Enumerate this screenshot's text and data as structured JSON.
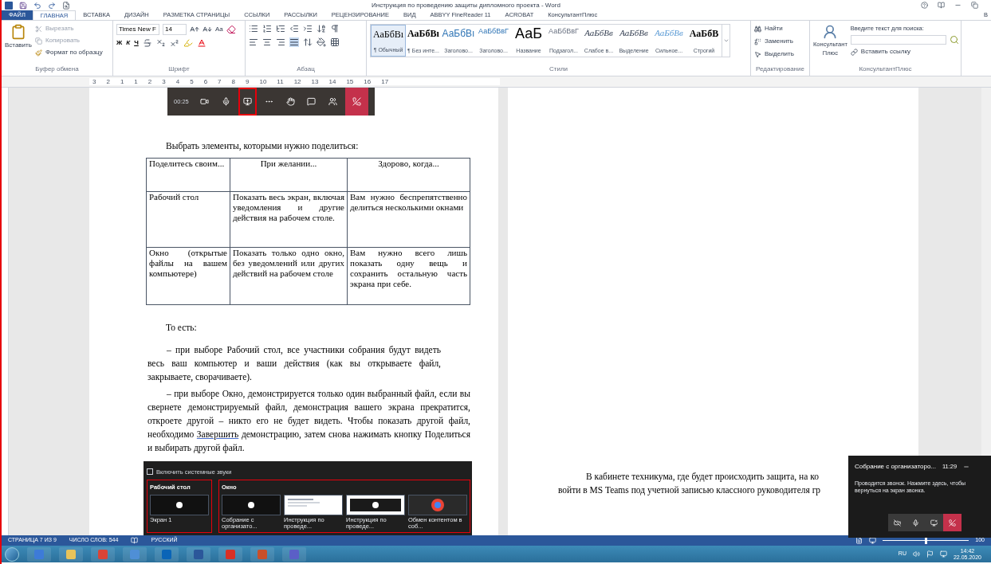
{
  "window": {
    "title": "Инструкция по проведению защиты дипломного проекта - Word",
    "account": "В"
  },
  "ribbon_tabs": [
    {
      "label": "ФАЙЛ",
      "kind": "file",
      "selected": false
    },
    {
      "label": "ГЛАВНАЯ",
      "kind": "tab",
      "selected": true
    },
    {
      "label": "ВСТАВКА",
      "kind": "tab",
      "selected": false
    },
    {
      "label": "ДИЗАЙН",
      "kind": "tab",
      "selected": false
    },
    {
      "label": "РАЗМЕТКА СТРАНИЦЫ",
      "kind": "tab",
      "selected": false
    },
    {
      "label": "ССЫЛКИ",
      "kind": "tab",
      "selected": false
    },
    {
      "label": "РАССЫЛКИ",
      "kind": "tab",
      "selected": false
    },
    {
      "label": "РЕЦЕНЗИРОВАНИЕ",
      "kind": "tab",
      "selected": false
    },
    {
      "label": "ВИД",
      "kind": "tab",
      "selected": false
    },
    {
      "label": "ABBYY FineReader 11",
      "kind": "tab",
      "selected": false
    },
    {
      "label": "ACROBAT",
      "kind": "tab",
      "selected": false
    },
    {
      "label": "КонсультантПлюс",
      "kind": "tab",
      "selected": false
    }
  ],
  "clipboard": {
    "label": "Буфер обмена",
    "paste": "Вставить",
    "cut": "Вырезать",
    "copy": "Копировать",
    "format_painter": "Формат по образцу"
  },
  "font": {
    "label": "Шрифт",
    "font_name": "Times New F",
    "font_size": "14",
    "change_case": "Aa",
    "bold": "Ж",
    "italic": "К",
    "underline": "Ч"
  },
  "paragraph": {
    "label": "Абзац"
  },
  "styles": {
    "label": "Стили",
    "items": [
      {
        "preview": "АаБбВı",
        "name": "¶ Обычный",
        "kind": "normal",
        "selected": true
      },
      {
        "preview": "АаБбВı",
        "name": "¶ Без инте...",
        "kind": "strong",
        "selected": false
      },
      {
        "preview": "АаБбВı",
        "name": "Заголово...",
        "kind": "heading",
        "selected": false
      },
      {
        "preview": "АаБбВвГ",
        "name": "Заголово...",
        "kind": "heading2",
        "selected": false
      },
      {
        "preview": "АаБ",
        "name": "Название",
        "kind": "title",
        "selected": false
      },
      {
        "preview": "АаБбВвГ",
        "name": "Подзагол...",
        "kind": "subtitle",
        "selected": false
      },
      {
        "preview": "АаБбВв",
        "name": "Слабое в...",
        "kind": "emphasis",
        "selected": false
      },
      {
        "preview": "АаБбВв",
        "name": "Выделение",
        "kind": "emphasis",
        "selected": false
      },
      {
        "preview": "АаБбВв",
        "name": "Сильное...",
        "kind": "intense",
        "selected": false
      },
      {
        "preview": "АаБбВ",
        "name": "Строгий",
        "kind": "strong",
        "selected": false
      }
    ]
  },
  "editing": {
    "label": "Редактирование",
    "find": "Найти",
    "replace": "Заменить",
    "select": "Выделить"
  },
  "konsultant": {
    "button_line1": "Консультант",
    "button_line2": "Плюс",
    "search_label": "Введите текст для поиска:",
    "insert_link": "Вставить ссылку",
    "label": "КонсультантПлюс"
  },
  "ruler": [
    "3",
    "2",
    "1",
    "1",
    "2",
    "3",
    "4",
    "5",
    "6",
    "7",
    "8",
    "9",
    "10",
    "11",
    "12",
    "13",
    "14",
    "15",
    "16",
    "17"
  ],
  "page_1": {
    "call_toolbar": {
      "time": "00:25",
      "buttons": [
        {
          "kind": "camera",
          "highlighted": false
        },
        {
          "kind": "mic",
          "highlighted": false
        },
        {
          "kind": "share",
          "highlighted": true
        },
        {
          "kind": "more",
          "highlighted": false
        },
        {
          "kind": "hand",
          "highlighted": false
        },
        {
          "kind": "chat",
          "highlighted": false
        },
        {
          "kind": "people",
          "highlighted": false
        },
        {
          "kind": "hangup",
          "highlighted": false
        }
      ]
    },
    "intro": "Выбрать элементы, которыми нужно поделиться:",
    "table": {
      "columns": [
        "Поделитесь своим...",
        "При желании...",
        "Здорово, когда..."
      ],
      "rows": [
        [
          "Рабочий стол",
          "Показать весь экран, включая уведомления и другие действия на рабочем столе.",
          "Вам нужно беспрепятственно делиться несколькими окнами"
        ],
        [
          "Окно (открытые файлы на вашем компьютере)",
          "Показать только одно окно, без уведомлений или других действий на рабочем столе",
          "Вам нужно всего лишь показать одну вещь и сохранить остальную часть экрана при себе."
        ]
      ]
    },
    "lead": "То есть:",
    "paragraph_1": "– при выборе Рабочий стол, все участники собрания будут видеть весь ваш компьютер и ваши действия (как вы открываете файл, закрываете, сворачиваете).",
    "paragraph_2": {
      "before": "– при выборе Окно, демонстрируется только один выбранный файл, если вы свернете демонстрируемый файл, демонстрация вашего экрана прекратится, откроете другой – никто его не будет видеть. Чтобы показать другой файл, необходимо",
      "link": "Завершить",
      "after": "демонстрацию, затем снова нажимать кнопку Поделиться и выбирать другой файл."
    },
    "share_panel": {
      "checkbox": {
        "label": "Включить системные звуки",
        "checked": false
      },
      "sections": [
        {
          "title": "Рабочий стол",
          "highlighted": true,
          "items": [
            {
              "caption": "Экран 1",
              "kind": "screen"
            }
          ]
        },
        {
          "title": "Окно",
          "highlighted": true,
          "items": [
            {
              "caption": "Собрание с организато...",
              "kind": "call"
            },
            {
              "caption": "Инструкция по проведе...",
              "kind": "document"
            },
            {
              "caption": "Инструкция по проведе...",
              "kind": "pdf"
            },
            {
              "caption": "Обмен контентом в соб...",
              "kind": "browser"
            }
          ]
        }
      ]
    }
  },
  "page_2": {
    "lines": [
      "В кабинете техникума, где будет происходить защита, на ко",
      "войти в MS Teams под учетной записью классного руководителя гр"
    ]
  },
  "call_popup": {
    "title": "Собрание с организаторо...",
    "time": "11:29",
    "message": "Проводится звонок. Нажмите здесь, чтобы вернуться на экран звонка."
  },
  "status_bar": {
    "page": "СТРАНИЦА 7 ИЗ 9",
    "words": "ЧИСЛО СЛОВ: 544",
    "language": "РУССКИЙ",
    "zoom": {
      "level": 0.5
    },
    "zoom_value": "100"
  },
  "taskbar": {
    "language": "RU",
    "time": "14:42",
    "date": "22.05.2020"
  }
}
